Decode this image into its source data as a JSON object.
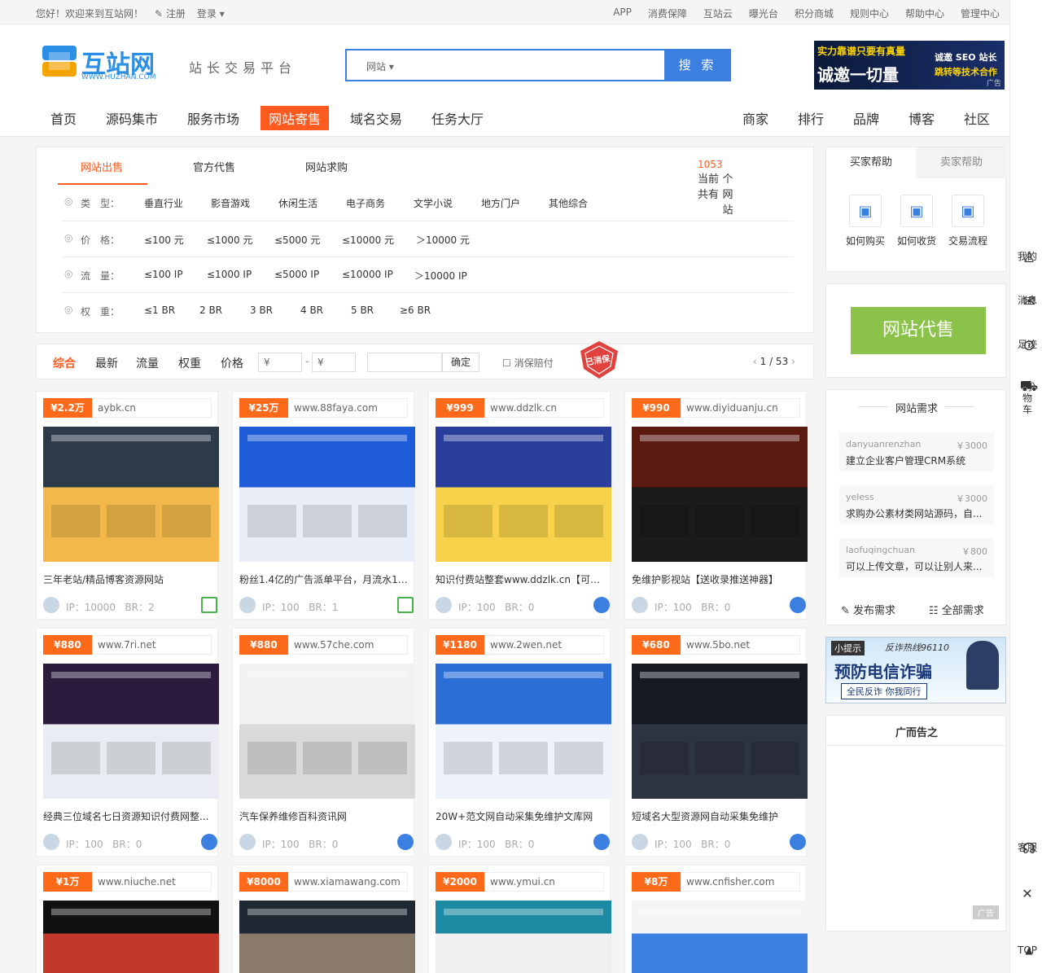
{
  "topbar": {
    "greeting": "您好！欢迎来到互站网！",
    "register": "注册",
    "login": "登录",
    "links": [
      "APP",
      "消费保障",
      "互站云",
      "曝光台",
      "积分商城",
      "规则中心",
      "帮助中心",
      "管理中心"
    ]
  },
  "header": {
    "logo_text": "互站网",
    "logo_sub": "WWW.HUZHAN.COM",
    "slogan": "站长交易平台",
    "search_select": "网站",
    "search_btn": "搜 索",
    "ad_text1": "实力靠谱只要有真量",
    "ad_text2": "诚邀一切量",
    "ad_text3": "诚邀 SEO 站长",
    "ad_text4": "跳转等技术合作",
    "ad_tag": "广告"
  },
  "nav": {
    "left": [
      "首页",
      "源码集市",
      "服务市场",
      "网站寄售",
      "域名交易",
      "任务大厅"
    ],
    "right": [
      "商家",
      "排行",
      "品牌",
      "博客",
      "社区"
    ],
    "active": "网站寄售"
  },
  "filter": {
    "tabs": [
      "网站出售",
      "官方代售",
      "网站求购"
    ],
    "count_pre": "当前共有",
    "count": "1053",
    "count_post": "个网站",
    "rows": [
      {
        "label": "类　型：",
        "opts": [
          "垂直行业",
          "影音游戏",
          "休闲生活",
          "电子商务",
          "文学小说",
          "地方门户",
          "其他综合"
        ]
      },
      {
        "label": "价　格：",
        "opts": [
          "≤100 元",
          "≤1000 元",
          "≤5000 元",
          "≤10000 元",
          "＞10000 元"
        ]
      },
      {
        "label": "流　量：",
        "opts": [
          "≤100 IP",
          "≤1000 IP",
          "≤5000 IP",
          "≤10000 IP",
          "＞10000 IP"
        ]
      },
      {
        "label": "权　重：",
        "opts": [
          "≤1 BR",
          "2 BR",
          "3 BR",
          "4 BR",
          "5 BR",
          "≥6 BR"
        ]
      }
    ]
  },
  "sortbar": {
    "items": [
      "综合",
      "最新",
      "流量",
      "权重",
      "价格"
    ],
    "yen1": "¥",
    "yen2": "¥",
    "dash": "-",
    "confirm": "确定",
    "check": "消保赔付",
    "stamp": "已消保",
    "page": "1 / 53"
  },
  "cards": [
    {
      "price": "¥2.2万",
      "url": "aybk.cn",
      "title": "三年老站/精品博客资源网站",
      "ip": "IP：10000",
      "br": "BR：2"
    },
    {
      "price": "¥25万",
      "url": "www.88faya.com",
      "title": "粉丝1.4亿的广告派单平台，月流水10...",
      "ip": "IP：100",
      "br": "BR：1"
    },
    {
      "price": "¥999",
      "url": "www.ddzlk.cn",
      "title": "知识付费站整套www.ddzlk.cn【可自...",
      "ip": "IP：100",
      "br": "BR：0"
    },
    {
      "price": "¥990",
      "url": "www.diyiduanju.cn",
      "title": "免维护影视站【送收录推送神器】",
      "ip": "IP：100",
      "br": "BR：0"
    },
    {
      "price": "¥880",
      "url": "www.7ri.net",
      "title": "经典三位域名七日资源知识付费网整...",
      "ip": "IP：100",
      "br": "BR：0"
    },
    {
      "price": "¥880",
      "url": "www.57che.com",
      "title": "汽车保养维修百科资讯网",
      "ip": "IP：100",
      "br": "BR：0"
    },
    {
      "price": "¥1180",
      "url": "www.2wen.net",
      "title": "20W+范文网自动采集免维护文库网",
      "ip": "IP：100",
      "br": "BR：0"
    },
    {
      "price": "¥680",
      "url": "www.5bo.net",
      "title": "短域名大型资源网自动采集免维护",
      "ip": "IP：100",
      "br": "BR：0"
    },
    {
      "price": "¥1万",
      "url": "www.niuche.net",
      "title": "",
      "ip": "",
      "br": ""
    },
    {
      "price": "¥8000",
      "url": "www.xiamawang.com",
      "title": "",
      "ip": "",
      "br": ""
    },
    {
      "price": "¥2000",
      "url": "www.ymui.cn",
      "title": "",
      "ip": "",
      "br": ""
    },
    {
      "price": "¥8万",
      "url": "www.cnfisher.com",
      "title": "",
      "ip": "",
      "br": ""
    }
  ],
  "right": {
    "tab_buy": "买家帮助",
    "tab_sell": "卖家帮助",
    "help": [
      "如何购买",
      "如何收货",
      "交易流程"
    ],
    "consign_btn": "网站代售",
    "demand_title": "网站需求",
    "demands": [
      {
        "user": "danyuanrenzhan",
        "price": "￥3000",
        "text": "建立企业客户管理CRM系统"
      },
      {
        "user": "yeless",
        "price": "￥3000",
        "text": "求购办公素材类网站源码，自..."
      },
      {
        "user": "laofuqingchuan",
        "price": "￥800",
        "text": "可以上传文章，可以让别人来..."
      }
    ],
    "post_demand": "发布需求",
    "all_demand": "全部需求",
    "tip_label": "小提示",
    "tip_line": "反诈热线96110",
    "tip_main": "预防电信诈骗",
    "tip_sub": "全民反诈 你我同行",
    "ad_title": "广而告之",
    "ad_tag": "广告"
  },
  "sidebar": {
    "items": [
      "我的",
      "消息",
      "足迹",
      "购物车",
      "客服",
      "TOP"
    ]
  }
}
